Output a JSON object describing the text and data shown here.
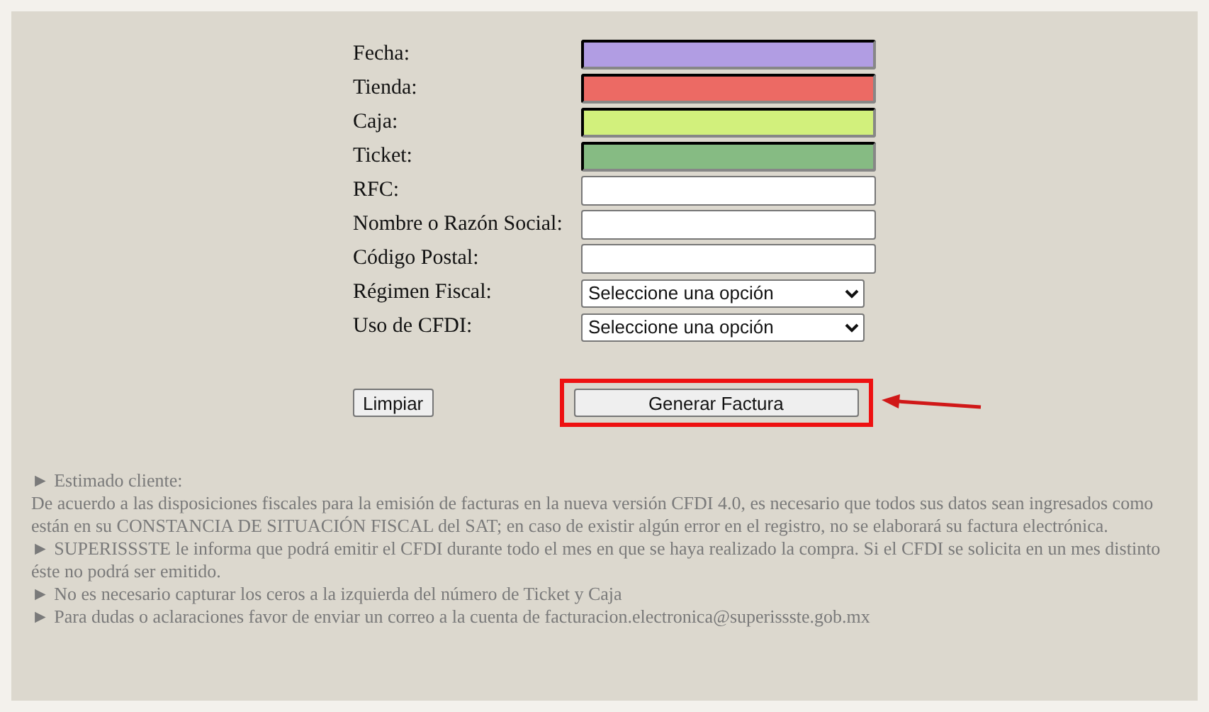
{
  "form": {
    "fields": [
      {
        "label": "Fecha:",
        "kind": "input",
        "color": "#b19de3"
      },
      {
        "label": "Tienda:",
        "kind": "input",
        "color": "#ec6a64"
      },
      {
        "label": "Caja:",
        "kind": "input",
        "color": "#d2f07c"
      },
      {
        "label": "Ticket:",
        "kind": "input",
        "color": "#86bb83"
      },
      {
        "label": "RFC:",
        "kind": "input"
      },
      {
        "label": "Nombre o Razón Social:",
        "kind": "input"
      },
      {
        "label": "Código Postal:",
        "kind": "input"
      },
      {
        "label": "Régimen Fiscal:",
        "kind": "select",
        "value": "Seleccione una opción"
      },
      {
        "label": "Uso de CFDI:",
        "kind": "select",
        "value": "Seleccione una opción"
      }
    ],
    "buttons": {
      "clear": "Limpiar",
      "submit": "Generar Factura",
      "submit_highlighted": true
    }
  },
  "notes": [
    "► Estimado cliente:",
    "De acuerdo a las disposiciones fiscales para la emisión de facturas en la nueva versión CFDI 4.0, es necesario que todos sus datos sean ingresados como están en su CONSTANCIA DE SITUACIÓN FISCAL del SAT; en caso de existir algún error en el registro, no se elaborará su factura electrónica.",
    "► SUPERISSSTE le informa que podrá emitir el CFDI durante todo el mes en que se haya realizado la compra. Si el CFDI se solicita en un mes distinto éste no podrá ser emitido.",
    "► No es necesario capturar los ceros a la izquierda del número de Ticket y Caja",
    "► Para dudas o aclaraciones favor de enviar un correo a la cuenta de facturacion.electronica@superissste.gob.mx"
  ]
}
